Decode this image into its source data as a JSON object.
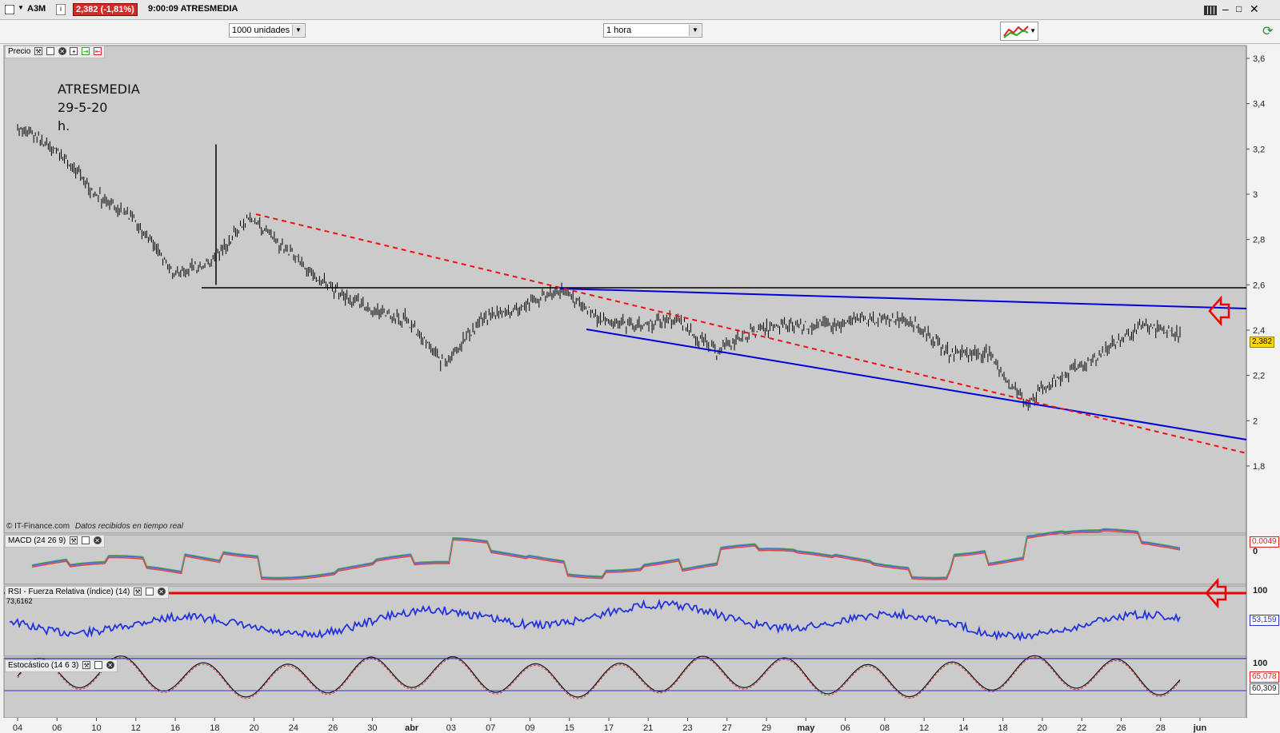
{
  "titlebar": {
    "symbol": "A3M",
    "info_icon": "info-icon",
    "price_badge": "2,382 (-1,81%)",
    "time_and_name": "9:00:09 ATRESMEDIA",
    "window_controls": [
      "menu-grid-icon",
      "minimize-icon",
      "maximize-icon",
      "close-icon"
    ]
  },
  "toolbar": {
    "units_select": "1000 unidades",
    "interval_select": "1 hora",
    "chart_type_icon": "chart-type-icon",
    "refresh_icon": "refresh-icon"
  },
  "price_panel": {
    "label": "Precio",
    "annotation_lines": [
      "ATRESMEDIA",
      "29-5-20",
      "h."
    ],
    "credit": "© IT-Finance.com",
    "credit_note": "Datos recibidos en tiempo real",
    "yticks": [
      "3,6",
      "3,4",
      "3,2",
      "3",
      "2,8",
      "2,6",
      "2,4",
      "2,2",
      "2",
      "1,8"
    ],
    "last_value": "2,382",
    "colors": {
      "background": "#cbcbcb",
      "candles": "#000000",
      "resistance": "#000000",
      "channel": "#0000dd",
      "trend": "#ee0000",
      "last_badge": "#ffd600"
    }
  },
  "macd_panel": {
    "label": "MACD (24 26 9)",
    "value": "0,0049",
    "ytick": "0"
  },
  "rsi_panel": {
    "label": "RSI - Fuerza Relativa (índice) (14)",
    "level_label": "73,6162",
    "value": "53,159",
    "ytick": "100"
  },
  "stoch_panel": {
    "label": "Estocástico (14 6 3)",
    "value1": "65,078",
    "value2": "60,309",
    "ytick": "100"
  },
  "xaxis": {
    "labels": [
      "04",
      "06",
      "10",
      "12",
      "16",
      "18",
      "20",
      "24",
      "26",
      "30",
      "abr",
      "03",
      "07",
      "09",
      "15",
      "17",
      "21",
      "23",
      "27",
      "29",
      "may",
      "06",
      "08",
      "12",
      "14",
      "18",
      "20",
      "22",
      "26",
      "28",
      "jun"
    ]
  },
  "chart_data": {
    "type": "line",
    "title": "ATRESMEDIA",
    "subtitle": "29-5-20",
    "xlabel": "",
    "ylabel": "",
    "ylim": [
      1.6,
      3.65
    ],
    "x": [
      "04",
      "06",
      "10",
      "12",
      "16",
      "18",
      "20",
      "24",
      "26",
      "30",
      "abr",
      "03",
      "07",
      "09",
      "15",
      "17",
      "21",
      "23",
      "27",
      "29",
      "may",
      "06",
      "08",
      "12",
      "14",
      "18",
      "20",
      "22",
      "26",
      "28",
      "jun"
    ],
    "series": [
      {
        "values": [
          3.3,
          3.2,
          3.0,
          2.9,
          2.65,
          2.7,
          2.9,
          2.75,
          2.6,
          2.5,
          2.45,
          2.25,
          2.45,
          2.5,
          2.58,
          2.45,
          2.42,
          2.45,
          2.3,
          2.4,
          2.42,
          2.42,
          2.45,
          2.45,
          2.3,
          2.3,
          2.08,
          2.2,
          2.3,
          2.42,
          2.382
        ]
      }
    ],
    "resistance_level": 2.59,
    "last_value": 2.382
  }
}
